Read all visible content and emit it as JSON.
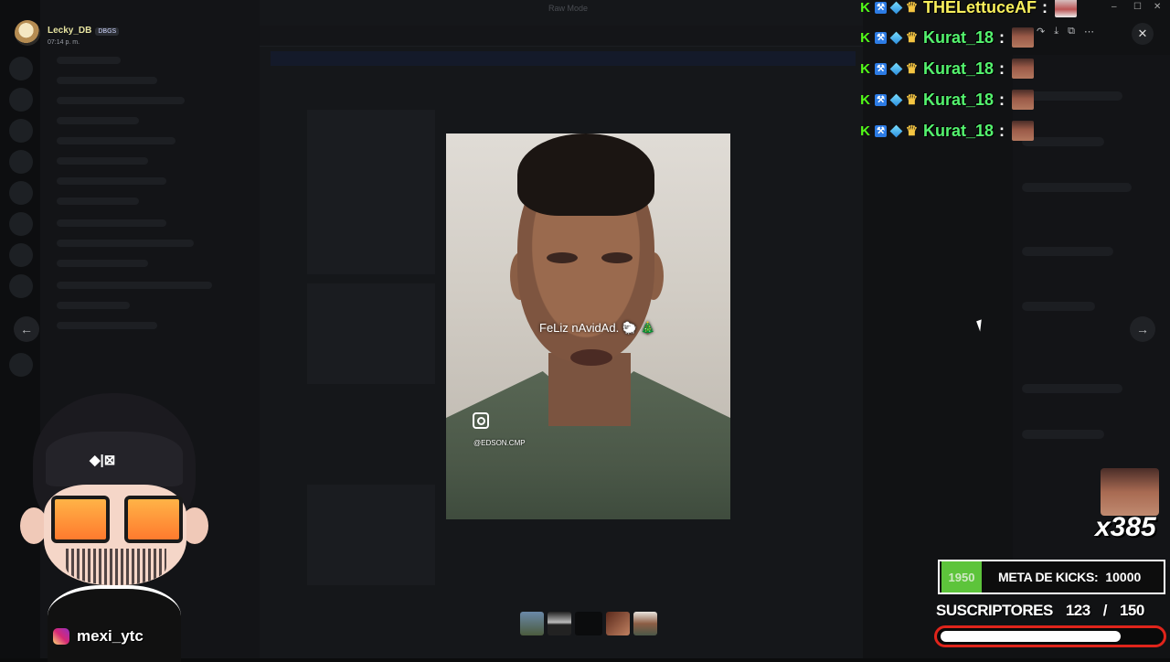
{
  "user": {
    "name": "Lecky_DB",
    "badge": "DBGS",
    "time": "07:14 p. m."
  },
  "viewer": {
    "window_title": "Raw Mode",
    "overlay_caption": "FeLiz nAvidAd. 🐑 🎄",
    "watermark_handle": "@EDSON.CMP",
    "prev_label": "←",
    "next_label": "→",
    "close_label": "✕",
    "actions": [
      "↷",
      "⤓",
      "⧉",
      "⋯"
    ]
  },
  "window_controls": [
    "–",
    "☐",
    "✕"
  ],
  "stream_chat": [
    {
      "username": "THELettuceAF",
      "color": "#f7ef5c",
      "badges": [
        "kick",
        "pickaxe",
        "gem",
        "crown"
      ]
    },
    {
      "username": "Kurat_18",
      "color": "#54f36e",
      "badges": [
        "kick",
        "pickaxe",
        "gem",
        "crown"
      ]
    },
    {
      "username": "Kurat_18",
      "color": "#54f36e",
      "badges": [
        "kick",
        "pickaxe",
        "gem",
        "crown"
      ]
    },
    {
      "username": "Kurat_18",
      "color": "#54f36e",
      "badges": [
        "kick",
        "pickaxe",
        "gem",
        "crown"
      ]
    },
    {
      "username": "Kurat_18",
      "color": "#54f36e",
      "badges": [
        "kick",
        "pickaxe",
        "gem",
        "crown"
      ]
    }
  ],
  "vtuber": {
    "logo": "◆|⊠",
    "instagram_handle": "mexi_ytc"
  },
  "combo": {
    "count": "x385"
  },
  "kick_goal": {
    "current": "1950",
    "label": "META DE KICKS:",
    "target": "10000"
  },
  "subs_goal": {
    "label": "SUSCRIPTORES",
    "current": "123",
    "separator": "/",
    "target": "150",
    "progress": 0.82
  },
  "colors": {
    "kick_green": "#53fc18",
    "goal_bar_red": "#e0241b",
    "goal_fill_green": "#5dc43b"
  }
}
